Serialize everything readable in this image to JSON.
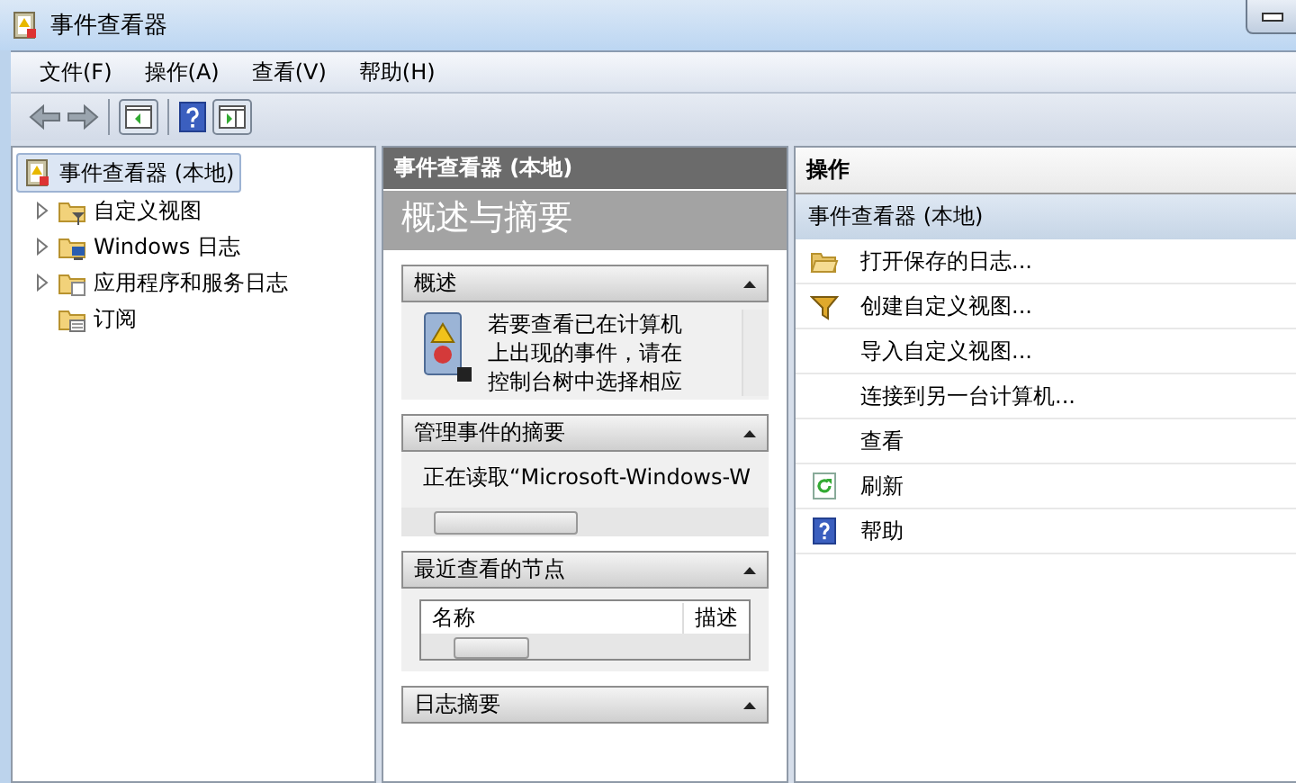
{
  "window": {
    "title": "事件查看器"
  },
  "menu": [
    "文件(F)",
    "操作(A)",
    "查看(V)",
    "帮助(H)"
  ],
  "tree": {
    "label": "事件查看器 (本地)",
    "selected": true,
    "children": [
      {
        "label": "自定义视图",
        "kind": "collapsed"
      },
      {
        "label": "Windows 日志",
        "kind": "collapsed"
      },
      {
        "label": "应用程序和服务日志",
        "kind": "collapsed"
      },
      {
        "label": "订阅",
        "kind": "leaf"
      }
    ]
  },
  "center": {
    "header": "事件查看器 (本地)",
    "title": "概述与摘要",
    "sections": [
      {
        "title": "概述",
        "expanded": true,
        "kind": "text",
        "lines": [
          "若要查看已在计算机",
          "上出现的事件，请在",
          "控制台树中选择相应"
        ]
      },
      {
        "title": "管理事件的摘要",
        "expanded": true,
        "kind": "scrolltext",
        "text": "正在读取“Microsoft-Windows-W"
      },
      {
        "title": "最近查看的节点",
        "expanded": true,
        "kind": "list",
        "columns": [
          "名称",
          "描述"
        ]
      },
      {
        "title": "日志摘要",
        "expanded": true,
        "kind": "header"
      }
    ]
  },
  "actions": {
    "header": "操作",
    "group": "事件查看器 (本地)",
    "items": [
      "打开保存的日志...",
      "创建自定义视图...",
      "导入自定义视图...",
      "连接到另一台计算机...",
      "查看",
      "刷新",
      "帮助"
    ]
  }
}
